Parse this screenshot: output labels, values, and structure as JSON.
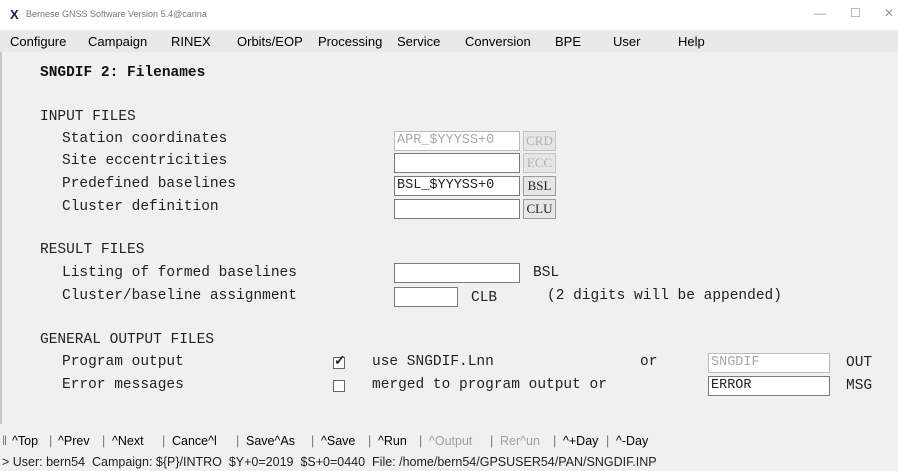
{
  "window": {
    "title": "Bernese GNSS Software Version 5.4@carina",
    "minimize": "—",
    "maximize": "☐",
    "close": "✕"
  },
  "menu": [
    "Configure",
    "Campaign",
    "RINEX",
    "Orbits/EOP",
    "Processing",
    "Service",
    "Conversion",
    "BPE",
    "User",
    "Help"
  ],
  "panel": {
    "title": "SNGDIF 2: Filenames",
    "input_files": {
      "header": "INPUT FILES",
      "rows": [
        {
          "label": "Station coordinates",
          "value": "APR_$YYYSS+0",
          "ext": "CRD"
        },
        {
          "label": "Site eccentricities",
          "value": "",
          "ext": "ECC"
        },
        {
          "label": "Predefined baselines",
          "value": "BSL_$YYYSS+0",
          "ext": "BSL"
        },
        {
          "label": "Cluster definition",
          "value": "",
          "ext": "CLU"
        }
      ]
    },
    "result_files": {
      "header": "RESULT FILES",
      "listing_label": "Listing of formed baselines",
      "listing_value": "",
      "listing_ext": "BSL",
      "cluster_label": "Cluster/baseline assignment",
      "cluster_value": "",
      "cluster_ext": "CLB",
      "cluster_note": "(2 digits will be appended)"
    },
    "general_output": {
      "header": "GENERAL OUTPUT FILES",
      "program_label": "Program output",
      "program_checked": true,
      "program_option": "use SNGDIF.Lnn",
      "program_or": "or",
      "program_value": "SNGDIF",
      "program_ext": "OUT",
      "error_label": "Error messages",
      "error_checked": false,
      "error_option": "merged to program output or",
      "error_value": "ERROR",
      "error_ext": "MSG"
    }
  },
  "buttons": [
    {
      "label": "^Top",
      "enabled": true
    },
    {
      "label": "^Prev",
      "enabled": true
    },
    {
      "label": "^Next",
      "enabled": true
    },
    {
      "label": "Cance^l",
      "enabled": true
    },
    {
      "label": "Save^As",
      "enabled": true
    },
    {
      "label": "^Save",
      "enabled": true
    },
    {
      "label": "^Run",
      "enabled": true
    },
    {
      "label": "^Output",
      "enabled": false
    },
    {
      "label": "Rer^un",
      "enabled": false
    },
    {
      "label": "^+Day",
      "enabled": true
    },
    {
      "label": "^-Day",
      "enabled": true
    }
  ],
  "status_bar": "> User: bern54  Campaign: ${P}/INTRO  $Y+0=2019  $S+0=0440  File: /home/bern54/GPSUSER54/PAN/SNGDIF.INP"
}
